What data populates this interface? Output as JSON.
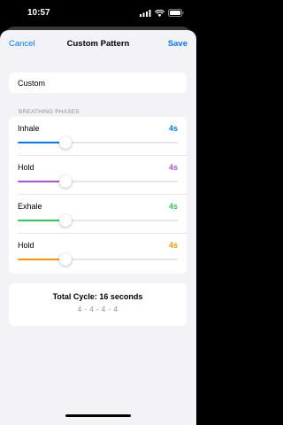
{
  "status_bar": {
    "time": "10:57",
    "icons": [
      "signal-icon",
      "wifi-icon",
      "battery-icon"
    ]
  },
  "nav": {
    "cancel_label": "Cancel",
    "title": "Custom Pattern",
    "save_label": "Save",
    "accent_color": "#007aff"
  },
  "pattern_name": {
    "value": "Custom"
  },
  "phases_section": {
    "header": "BREATHING PHASES",
    "phases": [
      {
        "label": "Inhale",
        "value_text": "4s",
        "color": "#007aff",
        "level": 0.3
      },
      {
        "label": "Hold",
        "value_text": "4s",
        "color": "#af52de",
        "level": 0.3
      },
      {
        "label": "Exhale",
        "value_text": "4s",
        "color": "#34c759",
        "level": 0.3
      },
      {
        "label": "Hold",
        "value_text": "4s",
        "color": "#ff9500",
        "level": 0.3
      }
    ]
  },
  "total": {
    "title": "Total Cycle: 16 seconds",
    "sequence": "4 - 4 - 4 - 4"
  }
}
